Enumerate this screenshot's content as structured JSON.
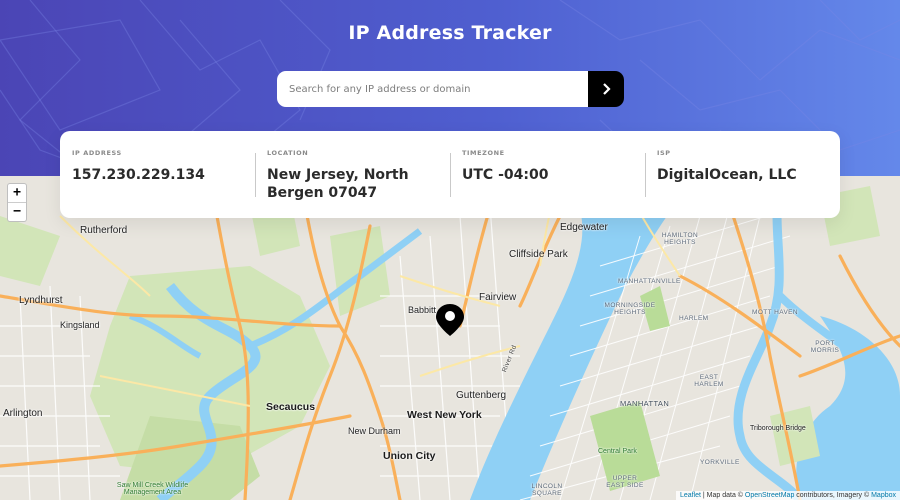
{
  "header": {
    "title": "IP Address Tracker",
    "search_placeholder": "Search for any IP address or domain",
    "search_value": "",
    "submit_icon": "chevron-right-icon"
  },
  "info": {
    "ip": {
      "label": "IP ADDRESS",
      "value": "157.230.229.134"
    },
    "location": {
      "label": "LOCATION",
      "value": "New Jersey, North Bergen 07047"
    },
    "timezone": {
      "label": "TIMEZONE",
      "value": "UTC -04:00"
    },
    "isp": {
      "label": "ISP",
      "value": "DigitalOcean, LLC"
    }
  },
  "map": {
    "zoom_in": "+",
    "zoom_out": "−",
    "marker_icon": "location-pin-icon",
    "labels": {
      "rutherford": "Rutherford",
      "lyndhurst": "Lyndhurst",
      "kingsland": "Kingsland",
      "arlington": "Arlington",
      "secaucus": "Secaucus",
      "new_durham": "New Durham",
      "union_city": "Union City",
      "west_new_york": "West New York",
      "guttenberg": "Guttenberg",
      "fairview": "Fairview",
      "babbitt": "Babbitt",
      "cliffside_park": "Cliffside Park",
      "edgewater": "Edgewater",
      "hamilton_heights": "HAMILTON HEIGHTS",
      "manhattanville": "MANHATTANVILLE",
      "harlem": "HARLEM",
      "morningside_heights": "MORNINGSIDE HEIGHTS",
      "mott_haven": "MOTT HAVEN",
      "port_morris": "PORT MORRIS",
      "east_harlem": "EAST HARLEM",
      "manhattan": "MANHATTAN",
      "central_park": "Central Park",
      "triborough_bridge": "Triborough Bridge",
      "yorkville": "YORKVILLE",
      "lincoln_square": "LINCOLN SQUARE",
      "upper_east_side": "UPPER EAST SIDE",
      "saw_mill": "Saw Mill Creek Wildlife Management Area",
      "edgewater_road": "River Rd"
    },
    "attribution": {
      "leaflet": "Leaflet",
      "text1": " | Map data © ",
      "osm": "OpenStreetMap",
      "text2": " contributors, Imagery © ",
      "mapbox": "Mapbox"
    }
  }
}
